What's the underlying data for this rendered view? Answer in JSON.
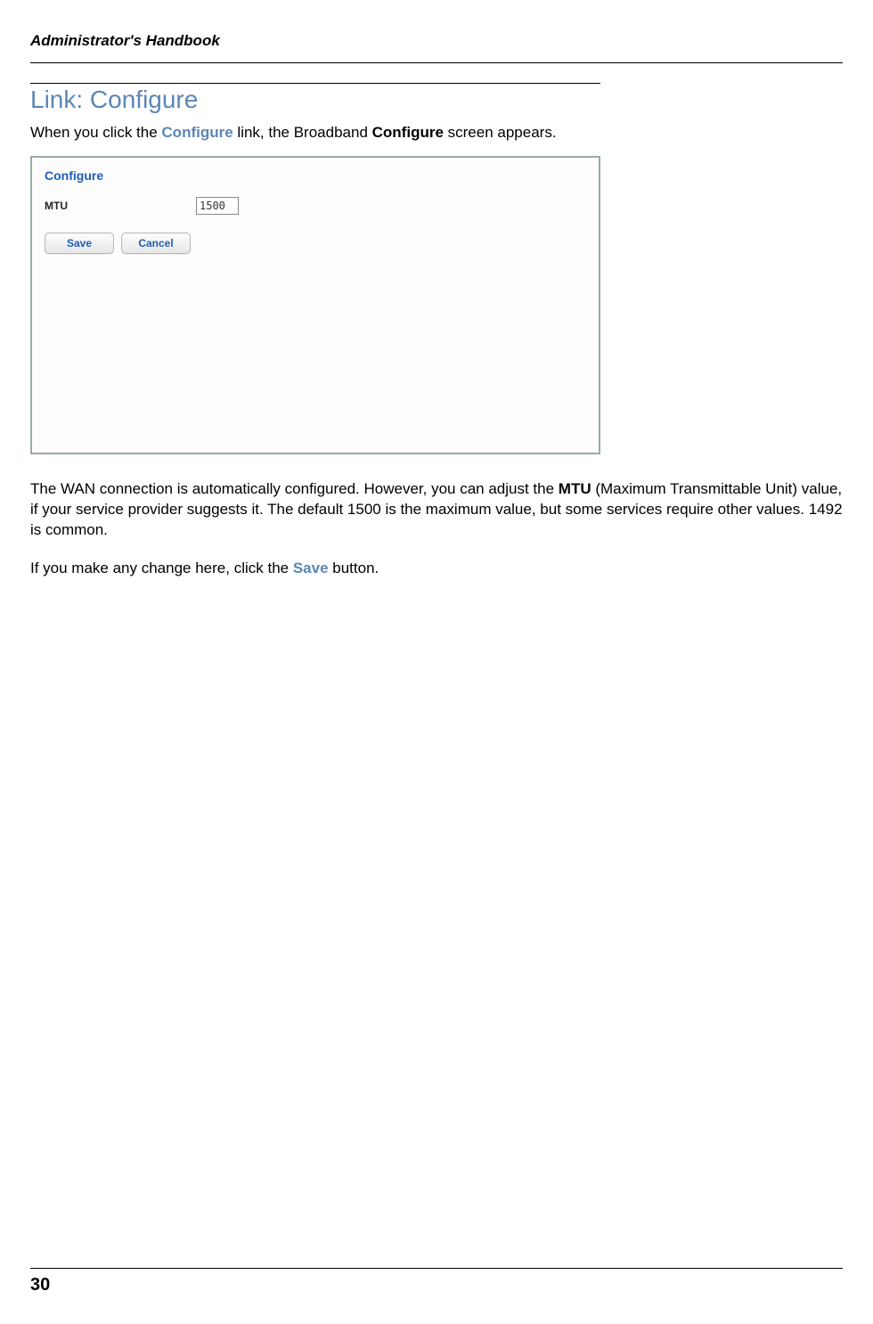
{
  "header": {
    "running_title": "Administrator's Handbook"
  },
  "section": {
    "title": "Link: Configure",
    "intro_prefix": "When you click the ",
    "intro_link": "Configure",
    "intro_mid": " link, the Broadband ",
    "intro_bold": "Configure",
    "intro_suffix": " screen appears."
  },
  "panel": {
    "title": "Configure",
    "mtu_label": "MTU",
    "mtu_value": "1500",
    "save_label": "Save",
    "cancel_label": "Cancel"
  },
  "paragraphs": {
    "p1_prefix": "The WAN connection is automatically configured. However, you can adjust the ",
    "p1_bold": "MTU",
    "p1_suffix": " (Maximum Transmittable Unit) value, if your service provider suggests it. The default 1500 is the maximum value, but some services require other values. 1492 is common.",
    "p2_prefix": "If you make any change here, click the ",
    "p2_save": "Save",
    "p2_suffix": " button."
  },
  "footer": {
    "page_number": "30"
  }
}
